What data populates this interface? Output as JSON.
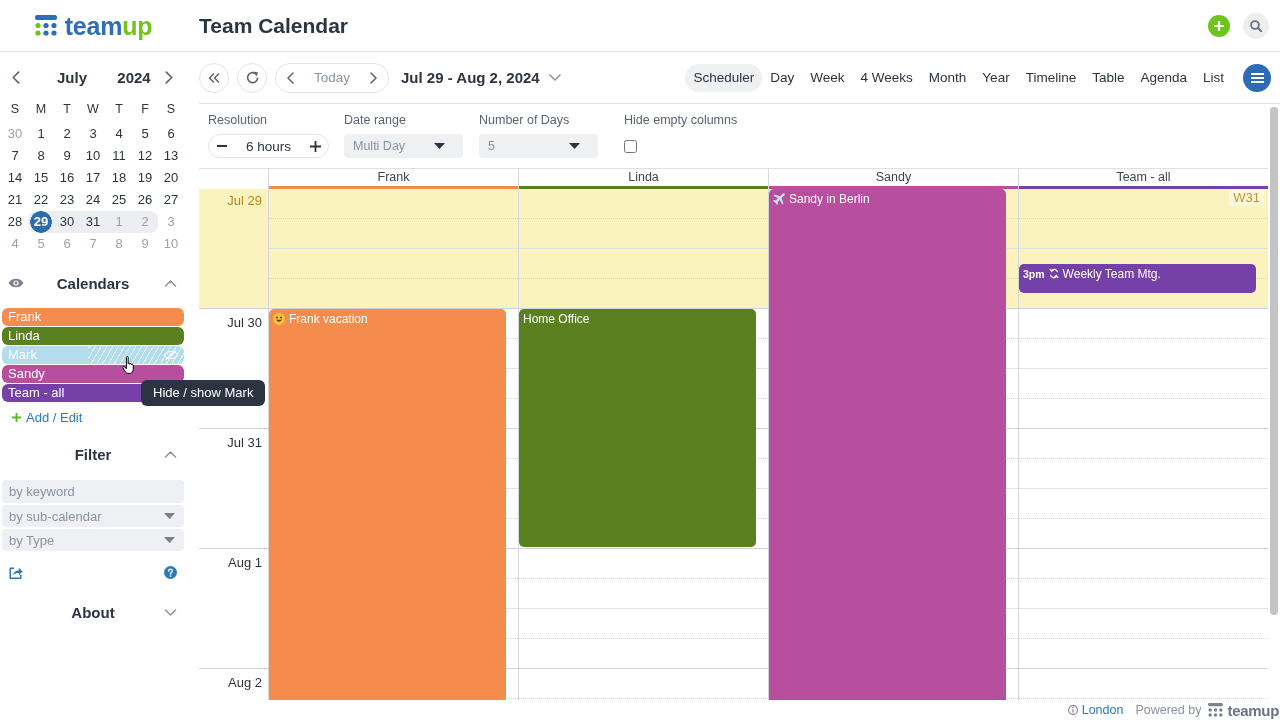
{
  "header": {
    "logo": [
      "team",
      "up"
    ],
    "title": "Team Calendar"
  },
  "mini_calendar": {
    "month": "July",
    "year": "2024",
    "weekdays": [
      "S",
      "M",
      "T",
      "W",
      "T",
      "F",
      "S"
    ],
    "weeks": [
      [
        {
          "day": "30",
          "other_month": true,
          "in_range": false,
          "selected": false
        },
        {
          "day": "1",
          "other_month": false,
          "in_range": false,
          "selected": false
        },
        {
          "day": "2",
          "other_month": false,
          "in_range": false,
          "selected": false
        },
        {
          "day": "3",
          "other_month": false,
          "in_range": false,
          "selected": false
        },
        {
          "day": "4",
          "other_month": false,
          "in_range": false,
          "selected": false
        },
        {
          "day": "5",
          "other_month": false,
          "in_range": false,
          "selected": false
        },
        {
          "day": "6",
          "other_month": false,
          "in_range": false,
          "selected": false
        }
      ],
      [
        {
          "day": "7",
          "other_month": false,
          "in_range": false,
          "selected": false
        },
        {
          "day": "8",
          "other_month": false,
          "in_range": false,
          "selected": false
        },
        {
          "day": "9",
          "other_month": false,
          "in_range": false,
          "selected": false
        },
        {
          "day": "10",
          "other_month": false,
          "in_range": false,
          "selected": false
        },
        {
          "day": "11",
          "other_month": false,
          "in_range": false,
          "selected": false
        },
        {
          "day": "12",
          "other_month": false,
          "in_range": false,
          "selected": false
        },
        {
          "day": "13",
          "other_month": false,
          "in_range": false,
          "selected": false
        }
      ],
      [
        {
          "day": "14",
          "other_month": false,
          "in_range": false,
          "selected": false
        },
        {
          "day": "15",
          "other_month": false,
          "in_range": false,
          "selected": false
        },
        {
          "day": "16",
          "other_month": false,
          "in_range": false,
          "selected": false
        },
        {
          "day": "17",
          "other_month": false,
          "in_range": false,
          "selected": false
        },
        {
          "day": "18",
          "other_month": false,
          "in_range": false,
          "selected": false
        },
        {
          "day": "19",
          "other_month": false,
          "in_range": false,
          "selected": false
        },
        {
          "day": "20",
          "other_month": false,
          "in_range": false,
          "selected": false
        }
      ],
      [
        {
          "day": "21",
          "other_month": false,
          "in_range": false,
          "selected": false
        },
        {
          "day": "22",
          "other_month": false,
          "in_range": false,
          "selected": false
        },
        {
          "day": "23",
          "other_month": false,
          "in_range": false,
          "selected": false
        },
        {
          "day": "24",
          "other_month": false,
          "in_range": false,
          "selected": false
        },
        {
          "day": "25",
          "other_month": false,
          "in_range": false,
          "selected": false
        },
        {
          "day": "26",
          "other_month": false,
          "in_range": false,
          "selected": false
        },
        {
          "day": "27",
          "other_month": false,
          "in_range": false,
          "selected": false
        }
      ],
      [
        {
          "day": "28",
          "other_month": false,
          "in_range": false,
          "selected": false
        },
        {
          "day": "29",
          "other_month": false,
          "in_range": true,
          "selected": true
        },
        {
          "day": "30",
          "other_month": false,
          "in_range": true,
          "selected": false
        },
        {
          "day": "31",
          "other_month": false,
          "in_range": true,
          "selected": false
        },
        {
          "day": "1",
          "other_month": true,
          "in_range": true,
          "selected": false
        },
        {
          "day": "2",
          "other_month": true,
          "in_range": true,
          "selected": false
        },
        {
          "day": "3",
          "other_month": true,
          "in_range": false,
          "selected": false
        }
      ],
      [
        {
          "day": "4",
          "other_month": true,
          "in_range": false,
          "selected": false
        },
        {
          "day": "5",
          "other_month": true,
          "in_range": false,
          "selected": false
        },
        {
          "day": "6",
          "other_month": true,
          "in_range": false,
          "selected": false
        },
        {
          "day": "7",
          "other_month": true,
          "in_range": false,
          "selected": false
        },
        {
          "day": "8",
          "other_month": true,
          "in_range": false,
          "selected": false
        },
        {
          "day": "9",
          "other_month": true,
          "in_range": false,
          "selected": false
        },
        {
          "day": "10",
          "other_month": true,
          "in_range": false,
          "selected": false
        }
      ]
    ]
  },
  "calendars": {
    "title": "Calendars",
    "expanded": true,
    "items": [
      {
        "name": "Frank",
        "color": "#f58b4c",
        "hidden": false
      },
      {
        "name": "Linda",
        "color": "#5a8020",
        "hidden": false
      },
      {
        "name": "Mark",
        "color": "#b3dcec",
        "hidden": true
      },
      {
        "name": "Sandy",
        "color": "#b84f9e",
        "hidden": false
      },
      {
        "name": "Team - all",
        "color": "#7540a8",
        "hidden": false
      }
    ],
    "add_edit": "Add / Edit",
    "tooltip": "Hide / show Mark"
  },
  "filter": {
    "title": "Filter",
    "expanded": true,
    "fields": [
      {
        "kind": "text",
        "placeholder": "by keyword"
      },
      {
        "kind": "select",
        "placeholder": "by sub-calendar"
      },
      {
        "kind": "select",
        "placeholder": "by Type"
      }
    ]
  },
  "about": {
    "title": "About",
    "expanded": false
  },
  "toolbar": {
    "today": "Today",
    "date_range": "Jul 29 - Aug 2, 2024",
    "views": [
      {
        "label": "Scheduler",
        "selected": true
      },
      {
        "label": "Day",
        "selected": false
      },
      {
        "label": "Week",
        "selected": false
      },
      {
        "label": "4 Weeks",
        "selected": false
      },
      {
        "label": "Month",
        "selected": false
      },
      {
        "label": "Year",
        "selected": false
      },
      {
        "label": "Timeline",
        "selected": false
      },
      {
        "label": "Table",
        "selected": false
      },
      {
        "label": "Agenda",
        "selected": false
      },
      {
        "label": "List",
        "selected": false
      }
    ]
  },
  "options": {
    "resolution": {
      "label": "Resolution",
      "value": "6 hours"
    },
    "date_range": {
      "label": "Date range",
      "value": "Multi Day",
      "disabled": true
    },
    "number_of_days": {
      "label": "Number of Days",
      "value": "5",
      "disabled": true
    },
    "hide_empty_columns": {
      "label": "Hide empty columns",
      "checked": false
    }
  },
  "scheduler": {
    "columns": [
      {
        "name": "Frank",
        "color": "#f58b4c"
      },
      {
        "name": "Linda",
        "color": "#5a8020"
      },
      {
        "name": "Sandy",
        "color": "#b84f9e"
      },
      {
        "name": "Team - all",
        "color": "#7540a8"
      }
    ],
    "days": [
      {
        "label": "Jul 29",
        "today": true,
        "week": "W31",
        "cells": [
          {
            "kind": "empty"
          },
          {
            "kind": "empty"
          },
          {
            "kind": "event",
            "event": {
              "kind": "travel",
              "title": "Sandy in Berlin",
              "recurring": false
            }
          },
          {
            "kind": "event",
            "event": {
              "kind": "meeting",
              "time": "3pm",
              "recurring": true,
              "title": "Weekly Team Mtg."
            }
          }
        ]
      },
      {
        "label": "Jul 30",
        "today": false,
        "cells": [
          {
            "kind": "event",
            "event": {
              "kind": "vacation",
              "title": "Frank vacation",
              "recurring": false
            }
          },
          {
            "kind": "event",
            "event": {
              "kind": "plain",
              "title": "Home Office",
              "recurring": false
            }
          },
          {
            "kind": "continued"
          },
          {
            "kind": "empty"
          }
        ]
      },
      {
        "label": "Jul 31",
        "today": false,
        "cells": [
          {
            "kind": "continued"
          },
          {
            "kind": "continued"
          },
          {
            "kind": "continued"
          },
          {
            "kind": "empty"
          }
        ]
      },
      {
        "label": "Aug 1",
        "today": false,
        "cells": [
          {
            "kind": "continued"
          },
          {
            "kind": "empty"
          },
          {
            "kind": "continued"
          },
          {
            "kind": "empty"
          }
        ]
      },
      {
        "label": "Aug 2",
        "today": false,
        "cells": [
          {
            "kind": "continued"
          },
          {
            "kind": "empty"
          },
          {
            "kind": "continued"
          },
          {
            "kind": "empty"
          }
        ]
      }
    ]
  },
  "footer": {
    "timezone": "London",
    "powered_by": "Powered by",
    "logo": "teamup"
  }
}
